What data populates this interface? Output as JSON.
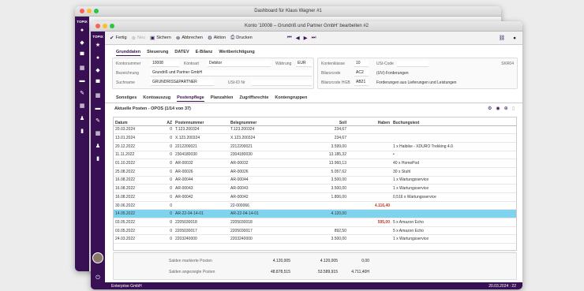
{
  "back_window": {
    "title": "Dashboard für Klaus Wagner #1"
  },
  "front_window": {
    "title": "Konto '10008 – Grundriß und Partner GmbH' bearbeiten #2"
  },
  "sidebar": {
    "logo": "TOPIX",
    "logo_back": "TOPIX"
  },
  "toolbar": {
    "fertig": "Fertig",
    "neu": "Neu",
    "sichern": "Sichern",
    "abbrechen": "Abbrechen",
    "aktion": "Aktion",
    "drucken": "Drucken"
  },
  "top_tabs": [
    "Grunddaten",
    "Steuerung",
    "DATEV",
    "E-Bilanz",
    "Wertberichtigung"
  ],
  "form": {
    "kontonummer_label": "Kontonummer",
    "kontonummer": "10008",
    "kontoart_label": "Kontoart",
    "kontoart": "Debitor",
    "waehrung_label": "Währung",
    "waehrung": "EUR",
    "bezeichnung_label": "Bezeichnung",
    "bezeichnung": "Grundriß und Partner GmbH",
    "suchname_label": "Suchname",
    "suchname": "GRUNDRISS&PARTNER",
    "ustid_label": "USt-ID Nr",
    "kontenklasse_label": "Kontenklasse",
    "kontenklasse": "10",
    "ustcode_label": "USt-Code",
    "ustcode": "",
    "skr": "SKR04",
    "bilanzcode_label": "Bilanzcode",
    "bilanzcode": "AC2",
    "bilanzcode_text": "(UV)-Forderungen",
    "bilanzhgb_label": "Bilanzcode HGB",
    "bilanzhgb": "AB21",
    "bilanzhgb_text": "Forderungen aus Lieferungen und Leistungen"
  },
  "sub_tabs": [
    "Sonstiges",
    "Kontoauszug",
    "Postenpflege",
    "Planzahlen",
    "Zugriffsrechte",
    "Kontengruppen"
  ],
  "list_title": "Aktuelle Posten - OPOS (1/14 von 37)",
  "columns": [
    "Datum",
    "AZ",
    "Postennummer",
    "Belegnummer",
    "Soll",
    "Haben",
    "Buchungstext"
  ],
  "rows": [
    [
      "20.03.2024",
      "0",
      "T.123.200324",
      "T.123.200324",
      "234,67",
      "",
      ""
    ],
    [
      "13.01.2024",
      "0",
      "X.123.200324",
      "X.123.200324",
      "234,67",
      "",
      ""
    ],
    [
      "20.12.2022",
      "0",
      "2212200021",
      "2212200021",
      "3.599,00",
      "",
      "1 x Haibike - XDURO Trekking 4.0"
    ],
    [
      "11.11.2022",
      "0",
      "2304180030",
      "2304180030",
      "13.185,32",
      "",
      "•"
    ],
    [
      "01.10.2022",
      "0",
      "AR-00032",
      "AR-00032",
      "13.960,13",
      "",
      "40 x HomePod"
    ],
    [
      "25.08.2022",
      "0",
      "AR-00026",
      "AR-00026",
      "5.057,62",
      "",
      "30 x Stuhl"
    ],
    [
      "16.08.2022",
      "0",
      "AR-00044",
      "AR-00044",
      "3.500,00",
      "",
      "1 x Wartungsservice"
    ],
    [
      "16.08.2022",
      "0",
      "AR-00043",
      "AR-00043",
      "3.500,00",
      "",
      "1 x Wartungsservice"
    ],
    [
      "16.08.2022",
      "0",
      "AR-00042",
      "AR-00042",
      "1.806,00",
      "",
      "0,516 x Wartungsservice"
    ],
    [
      "30.06.2022",
      "0",
      "",
      "22-000066",
      "",
      "4.116,40",
      ""
    ],
    [
      "14.05.2022",
      "0",
      "AR-22-04-14-01",
      "AR-22-04-14-01",
      "4.120,00",
      "",
      ""
    ],
    [
      "03.05.2022",
      "0",
      "2205030018",
      "2205030018",
      "",
      "595,00",
      "5 x Amazon Echo"
    ],
    [
      "03.05.2022",
      "0",
      "2205030017",
      "2205030017",
      "892,50",
      "",
      "5 x Amazon Echo"
    ],
    [
      "24.03.2022",
      "0",
      "2203240000",
      "2203240000",
      "3.500,00",
      "",
      "1 x Wartungsservice"
    ]
  ],
  "totals": {
    "marked_label": "Salden markierte Posten",
    "marked_soll": "4.120,005",
    "marked_haben": "4.120,005",
    "marked_saldo": "0,00",
    "shown_label": "Salden angezeigte Posten",
    "shown_soll": "48.878,515",
    "shown_haben": "53.589,915",
    "shown_saldo": "4.711,40H"
  },
  "status": {
    "company": "Enterprise GmbH",
    "datetime": "20.03.2024 : 22"
  },
  "colors": {
    "sidebar": "#3a1054",
    "selection": "#7fd3ec",
    "credit": "#c0392b"
  }
}
